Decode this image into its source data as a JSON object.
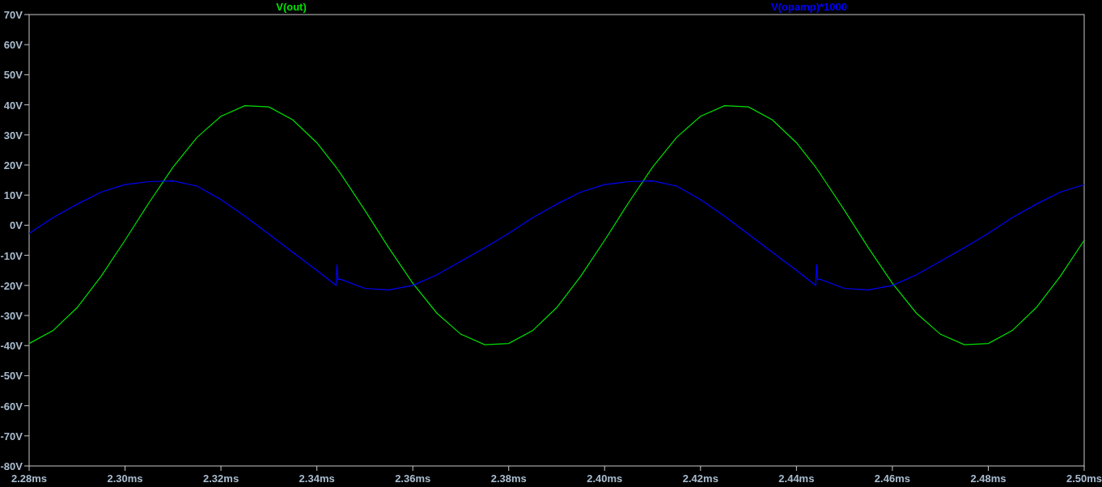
{
  "plot": {
    "chart_data": {
      "type": "line",
      "x": [
        2.28,
        2.285,
        2.29,
        2.295,
        2.3,
        2.305,
        2.31,
        2.315,
        2.32,
        2.325,
        2.33,
        2.335,
        2.34,
        2.344,
        2.3442,
        2.3444,
        2.345,
        2.35,
        2.355,
        2.36,
        2.365,
        2.37,
        2.375,
        2.38,
        2.385,
        2.39,
        2.395,
        2.4,
        2.405,
        2.41,
        2.415,
        2.42,
        2.425,
        2.43,
        2.435,
        2.44,
        2.444,
        2.4442,
        2.4444,
        2.445,
        2.45,
        2.455,
        2.46,
        2.465,
        2.47,
        2.475,
        2.48,
        2.485,
        2.49,
        2.495,
        2.5
      ],
      "series": [
        {
          "name": "V(out)",
          "color": "#00e000",
          "values": [
            -39.3,
            -35.0,
            -27.4,
            -17.0,
            -5.0,
            7.5,
            19.3,
            29.2,
            36.2,
            39.7,
            39.3,
            35.0,
            27.4,
            19.3,
            18.8,
            18.4,
            17.0,
            5.0,
            -7.5,
            -19.3,
            -29.2,
            -36.2,
            -39.7,
            -39.3,
            -35.0,
            -27.4,
            -17.0,
            -5.0,
            7.5,
            19.3,
            29.2,
            36.2,
            39.7,
            39.3,
            35.0,
            27.4,
            19.3,
            18.8,
            18.4,
            17.0,
            5.0,
            -7.5,
            -19.3,
            -29.2,
            -36.2,
            -39.7,
            -39.3,
            -35.0,
            -27.4,
            -17.0,
            -5.0
          ]
        },
        {
          "name": "V(opamp)*1000",
          "color": "#0000ff",
          "values": [
            -2.7,
            2.5,
            7,
            11,
            13.5,
            14.5,
            14.7,
            13,
            8.5,
            3,
            -3,
            -9,
            -15,
            -20,
            -13,
            -18,
            -18,
            -21,
            -21.5,
            -20,
            -16.5,
            -12,
            -7.5,
            -2.7,
            2.5,
            7,
            11,
            13.5,
            14.5,
            14.7,
            13,
            8.5,
            3,
            -3,
            -9,
            -15,
            -20,
            -13,
            -18,
            -18,
            -21,
            -21.5,
            -20,
            -16.5,
            -12,
            -7.5,
            -2.7,
            2.5,
            7,
            11,
            13.5
          ]
        }
      ],
      "xlim": [
        2.28,
        2.5
      ],
      "ylim": [
        -80,
        70
      ],
      "xticks": [
        {
          "value": 2.28,
          "label": "2.28ms"
        },
        {
          "value": 2.3,
          "label": "2.30ms"
        },
        {
          "value": 2.32,
          "label": "2.32ms"
        },
        {
          "value": 2.34,
          "label": "2.34ms"
        },
        {
          "value": 2.36,
          "label": "2.36ms"
        },
        {
          "value": 2.38,
          "label": "2.38ms"
        },
        {
          "value": 2.4,
          "label": "2.40ms"
        },
        {
          "value": 2.42,
          "label": "2.42ms"
        },
        {
          "value": 2.44,
          "label": "2.44ms"
        },
        {
          "value": 2.46,
          "label": "2.46ms"
        },
        {
          "value": 2.48,
          "label": "2.48ms"
        },
        {
          "value": 2.5,
          "label": "2.50ms"
        }
      ],
      "yticks": [
        {
          "value": 70,
          "label": "70V"
        },
        {
          "value": 60,
          "label": "60V"
        },
        {
          "value": 50,
          "label": "50V"
        },
        {
          "value": 40,
          "label": "40V"
        },
        {
          "value": 30,
          "label": "30V"
        },
        {
          "value": 20,
          "label": "20V"
        },
        {
          "value": 10,
          "label": "10V"
        },
        {
          "value": 0,
          "label": "0V"
        },
        {
          "value": -10,
          "label": "-10V"
        },
        {
          "value": -20,
          "label": "-20V"
        },
        {
          "value": -30,
          "label": "-30V"
        },
        {
          "value": -40,
          "label": "-40V"
        },
        {
          "value": -50,
          "label": "-50V"
        },
        {
          "value": -60,
          "label": "-60V"
        },
        {
          "value": -70,
          "label": "-70V"
        },
        {
          "value": -80,
          "label": "-80V"
        }
      ]
    }
  }
}
